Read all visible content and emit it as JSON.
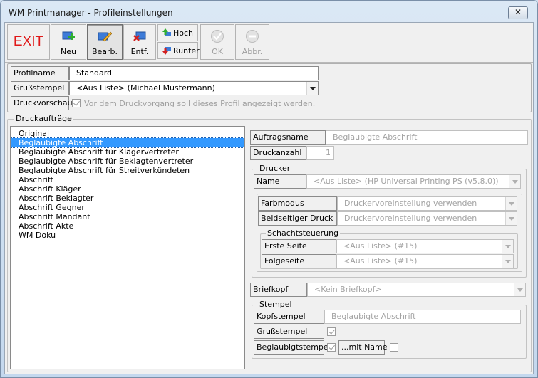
{
  "window": {
    "title": "WM Printmanager - Profileinstellungen",
    "close_label": "✕"
  },
  "toolbar": {
    "exit_label": "EXIT",
    "buttons": [
      {
        "name": "new",
        "label": "Neu",
        "icon": "new-doc-plus-icon",
        "pressed": false,
        "enabled": true
      },
      {
        "name": "edit",
        "label": "Bearb.",
        "icon": "edit-pencil-icon",
        "pressed": true,
        "enabled": true
      },
      {
        "name": "delete",
        "label": "Entf.",
        "icon": "delete-x-icon",
        "pressed": false,
        "enabled": true
      },
      {
        "name": "ok",
        "label": "OK",
        "icon": "ok-check-icon",
        "pressed": false,
        "enabled": false
      },
      {
        "name": "cancel",
        "label": "Abbr.",
        "icon": "cancel-minus-icon",
        "pressed": false,
        "enabled": false
      }
    ],
    "up_label": "Hoch",
    "down_label": "Runter"
  },
  "profile": {
    "name_label": "Profilname",
    "name_value": "Standard",
    "greeting_label": "Grußstempel",
    "greeting_value": "<Aus Liste> (Michael Mustermann)",
    "preview_label": "Druckvorschau",
    "preview_text": "Vor dem Druckvorgang soll dieses Profil angezeigt werden.",
    "preview_checked": true
  },
  "jobs": {
    "group_title": "Druckaufträge",
    "items": [
      "Original",
      "Beglaubigte Abschrift",
      "Beglaubigte Abschrift für Klägervertreter",
      "Beglaubigte Abschrift für Beklagtenvertreter",
      "Beglaubigte Abschrift für Streitverkündeten",
      "Abschrift",
      "Abschrift Kläger",
      "Abschrift Beklagter",
      "Abschrift Gegner",
      "Abschrift Mandant",
      "Abschrift Akte",
      "WM Doku"
    ],
    "selected_index": 1
  },
  "details": {
    "job_name_label": "Auftragsname",
    "job_name_value": "Beglaubigte Abschrift",
    "count_label": "Druckanzahl",
    "count_value": "1",
    "printer": {
      "group_title": "Drucker",
      "name_label": "Name",
      "name_value": "<Aus Liste> (HP Universal Printing PS (v5.8.0))",
      "color_label": "Farbmodus",
      "color_value": "Druckervoreinstellung verwenden",
      "duplex_label": "Beidseitiger Druck",
      "duplex_value": "Druckervoreinstellung verwenden",
      "tray": {
        "group_title": "Schachtsteuerung",
        "first_label": "Erste Seite",
        "first_value": "<Aus Liste> (#15)",
        "next_label": "Folgeseite",
        "next_value": "<Aus Liste> (#15)"
      }
    },
    "letterhead_label": "Briefkopf",
    "letterhead_value": "<Kein Briefkopf>",
    "stamp": {
      "group_title": "Stempel",
      "head_label": "Kopfstempel",
      "head_value": "Beglaubigte Abschrift",
      "greeting_label": "Grußstempel",
      "greeting_checked": true,
      "certified_label": "Beglaubigtstempel",
      "certified_checked": true,
      "with_name_label": "...mit Name",
      "with_name_checked": false
    }
  }
}
